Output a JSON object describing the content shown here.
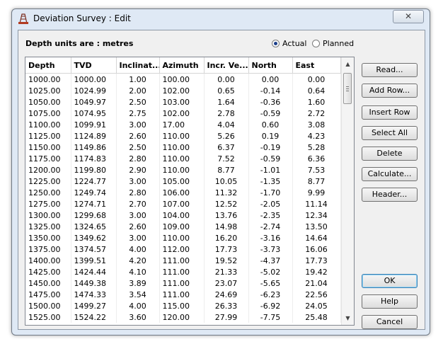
{
  "window": {
    "title": "Deviation Survey : Edit",
    "close_glyph": "✕"
  },
  "header": {
    "depth_units": "Depth units are : metres"
  },
  "mode": {
    "actual_label": "Actual",
    "planned_label": "Planned",
    "selected": "Actual"
  },
  "table": {
    "columns": [
      "Depth",
      "TVD",
      "Inclinat...",
      "Azimuth",
      "Incr. Ve...",
      "North",
      "East"
    ],
    "rows": [
      [
        "1000.00",
        "1000.00",
        "1.00",
        "100.00",
        "0.00",
        "0.00",
        "0.00"
      ],
      [
        "1025.00",
        "1024.99",
        "2.00",
        "102.00",
        "0.65",
        "-0.14",
        "0.64"
      ],
      [
        "1050.00",
        "1049.97",
        "2.50",
        "103.00",
        "1.64",
        "-0.36",
        "1.60"
      ],
      [
        "1075.00",
        "1074.95",
        "2.75",
        "102.00",
        "2.78",
        "-0.59",
        "2.72"
      ],
      [
        "1100.00",
        "1099.91",
        "3.00",
        "17.00",
        "4.04",
        "0.60",
        "3.08"
      ],
      [
        "1125.00",
        "1124.89",
        "2.60",
        "110.00",
        "5.26",
        "0.19",
        "4.23"
      ],
      [
        "1150.00",
        "1149.86",
        "2.50",
        "110.00",
        "6.37",
        "-0.19",
        "5.28"
      ],
      [
        "1175.00",
        "1174.83",
        "2.80",
        "110.00",
        "7.52",
        "-0.59",
        "6.36"
      ],
      [
        "1200.00",
        "1199.80",
        "2.90",
        "110.00",
        "8.77",
        "-1.01",
        "7.53"
      ],
      [
        "1225.00",
        "1224.77",
        "3.00",
        "105.00",
        "10.05",
        "-1.35",
        "8.77"
      ],
      [
        "1250.00",
        "1249.74",
        "2.80",
        "106.00",
        "11.32",
        "-1.70",
        "9.99"
      ],
      [
        "1275.00",
        "1274.71",
        "2.70",
        "107.00",
        "12.52",
        "-2.05",
        "11.14"
      ],
      [
        "1300.00",
        "1299.68",
        "3.00",
        "104.00",
        "13.76",
        "-2.35",
        "12.34"
      ],
      [
        "1325.00",
        "1324.65",
        "2.60",
        "109.00",
        "14.98",
        "-2.74",
        "13.50"
      ],
      [
        "1350.00",
        "1349.62",
        "3.00",
        "110.00",
        "16.20",
        "-3.16",
        "14.64"
      ],
      [
        "1375.00",
        "1374.57",
        "4.00",
        "112.00",
        "17.73",
        "-3.73",
        "16.06"
      ],
      [
        "1400.00",
        "1399.51",
        "4.20",
        "111.00",
        "19.52",
        "-4.37",
        "17.73"
      ],
      [
        "1425.00",
        "1424.44",
        "4.10",
        "111.00",
        "21.33",
        "-5.02",
        "19.42"
      ],
      [
        "1450.00",
        "1449.38",
        "3.89",
        "111.00",
        "23.07",
        "-5.65",
        "21.04"
      ],
      [
        "1475.00",
        "1474.33",
        "3.54",
        "111.00",
        "24.69",
        "-6.23",
        "22.56"
      ],
      [
        "1500.00",
        "1499.27",
        "4.00",
        "115.00",
        "26.33",
        "-6.92",
        "24.05"
      ],
      [
        "1525.00",
        "1524.22",
        "3.60",
        "120.00",
        "27.99",
        "-7.75",
        "25.48"
      ]
    ]
  },
  "buttons": {
    "read": "Read...",
    "add_row": "Add Row...",
    "insert_row": "Insert Row",
    "select_all": "Select All",
    "delete": "Delete",
    "calculate": "Calculate...",
    "header": "Header...",
    "ok": "OK",
    "help": "Help",
    "cancel": "Cancel"
  },
  "icons": {
    "app": "rig-icon",
    "scroll_up": "scroll-up-arrow",
    "scroll_down": "scroll-down-arrow"
  }
}
